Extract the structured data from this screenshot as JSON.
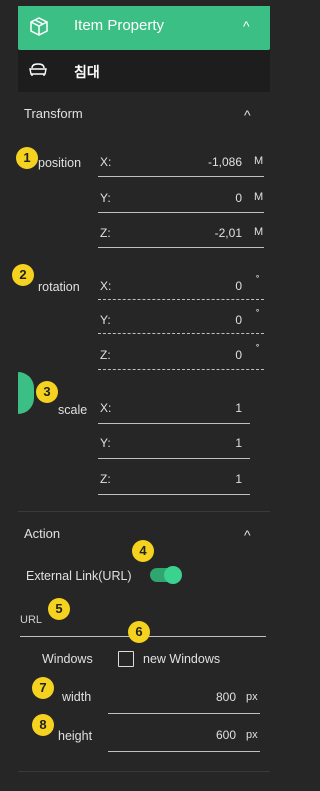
{
  "header": {
    "title": "Item Property",
    "icon": "cube-icon",
    "collapse_icon": "chevron-up-icon"
  },
  "item": {
    "name": "침대",
    "icon": "sofa-icon"
  },
  "transform": {
    "title": "Transform",
    "position": {
      "label": "position",
      "x": "-1,086",
      "y": "0",
      "z": "-2,01",
      "unit": "M"
    },
    "rotation": {
      "label": "rotation",
      "x": "0",
      "y": "0",
      "z": "0",
      "unit": "˚"
    },
    "scale": {
      "label": "scale",
      "x": "1",
      "y": "1",
      "z": "1"
    },
    "axis": {
      "x": "X:",
      "y": "Y:",
      "z": "Z:"
    }
  },
  "action": {
    "title": "Action",
    "external_link_label": "External Link(URL)",
    "external_link_on": true,
    "url_placeholder": "URL",
    "windows_label": "Windows",
    "new_windows_label": "new Windows",
    "new_windows_checked": false,
    "width_label": "width",
    "width_value": "800",
    "width_unit": "px",
    "height_label": "height",
    "height_value": "600",
    "height_unit": "px"
  },
  "badges": [
    "1",
    "2",
    "3",
    "4",
    "5",
    "6",
    "7",
    "8"
  ],
  "colors": {
    "accent": "#3bbf84",
    "badge": "#f5d21f",
    "background": "#262626"
  }
}
